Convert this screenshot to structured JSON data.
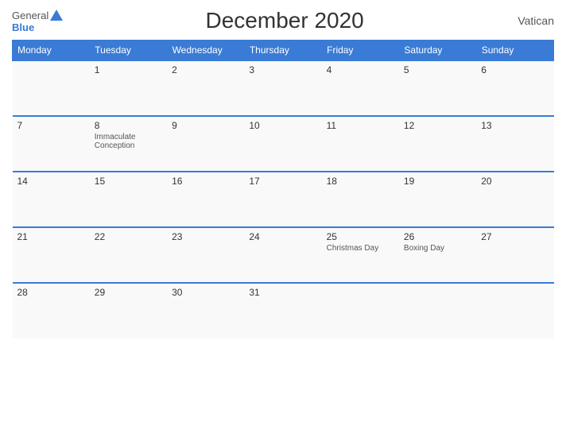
{
  "header": {
    "title": "December 2020",
    "country": "Vatican",
    "logo_general": "General",
    "logo_blue": "Blue"
  },
  "weekdays": [
    "Monday",
    "Tuesday",
    "Wednesday",
    "Thursday",
    "Friday",
    "Saturday",
    "Sunday"
  ],
  "weeks": [
    [
      {
        "day": "",
        "holiday": ""
      },
      {
        "day": "1",
        "holiday": ""
      },
      {
        "day": "2",
        "holiday": ""
      },
      {
        "day": "3",
        "holiday": ""
      },
      {
        "day": "4",
        "holiday": ""
      },
      {
        "day": "5",
        "holiday": ""
      },
      {
        "day": "6",
        "holiday": ""
      }
    ],
    [
      {
        "day": "7",
        "holiday": ""
      },
      {
        "day": "8",
        "holiday": "Immaculate Conception"
      },
      {
        "day": "9",
        "holiday": ""
      },
      {
        "day": "10",
        "holiday": ""
      },
      {
        "day": "11",
        "holiday": ""
      },
      {
        "day": "12",
        "holiday": ""
      },
      {
        "day": "13",
        "holiday": ""
      }
    ],
    [
      {
        "day": "14",
        "holiday": ""
      },
      {
        "day": "15",
        "holiday": ""
      },
      {
        "day": "16",
        "holiday": ""
      },
      {
        "day": "17",
        "holiday": ""
      },
      {
        "day": "18",
        "holiday": ""
      },
      {
        "day": "19",
        "holiday": ""
      },
      {
        "day": "20",
        "holiday": ""
      }
    ],
    [
      {
        "day": "21",
        "holiday": ""
      },
      {
        "day": "22",
        "holiday": ""
      },
      {
        "day": "23",
        "holiday": ""
      },
      {
        "day": "24",
        "holiday": ""
      },
      {
        "day": "25",
        "holiday": "Christmas Day"
      },
      {
        "day": "26",
        "holiday": "Boxing Day"
      },
      {
        "day": "27",
        "holiday": ""
      }
    ],
    [
      {
        "day": "28",
        "holiday": ""
      },
      {
        "day": "29",
        "holiday": ""
      },
      {
        "day": "30",
        "holiday": ""
      },
      {
        "day": "31",
        "holiday": ""
      },
      {
        "day": "",
        "holiday": ""
      },
      {
        "day": "",
        "holiday": ""
      },
      {
        "day": "",
        "holiday": ""
      }
    ]
  ]
}
